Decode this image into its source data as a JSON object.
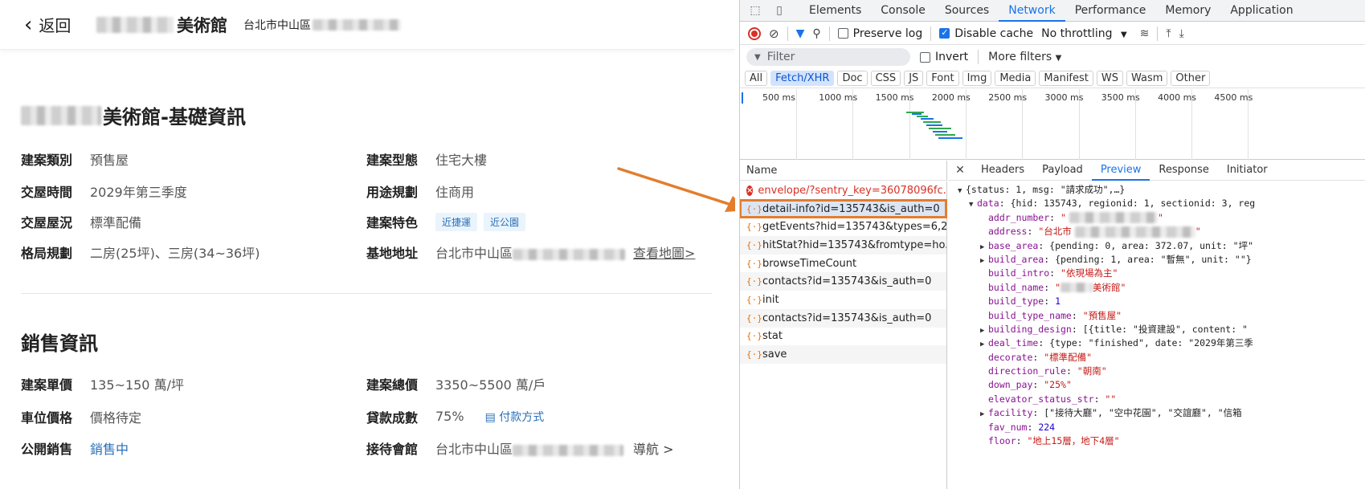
{
  "site": {
    "back_label": "返回",
    "title_suffix": "美術館",
    "address_prefix": "台北市中山區",
    "basic_section": {
      "title_suffix": "美術館-基礎資訊",
      "left": [
        {
          "key": "建案類別",
          "value": "預售屋"
        },
        {
          "key": "交屋時間",
          "value": "2029年第三季度"
        },
        {
          "key": "交屋屋況",
          "value": "標準配備"
        },
        {
          "key": "格局規劃",
          "value": "二房(25坪)、三房(34~36坪)"
        }
      ],
      "right": [
        {
          "key": "建案型態",
          "value": "住宅大樓"
        },
        {
          "key": "用途規劃",
          "value": "住商用"
        },
        {
          "key": "建案特色",
          "tags": [
            "近捷運",
            "近公園"
          ]
        },
        {
          "key": "基地地址",
          "value": "台北市中山區",
          "link": "查看地圖>"
        }
      ]
    },
    "sales_section": {
      "title": "銷售資訊",
      "left": [
        {
          "key": "建案單價",
          "value": "135~150 萬/坪"
        },
        {
          "key": "車位價格",
          "value": "價格待定"
        },
        {
          "key": "公開銷售",
          "value": "銷售中"
        }
      ],
      "right": [
        {
          "key": "建案總價",
          "value": "3350~5500 萬/戶"
        },
        {
          "key": "貸款成數",
          "value": "75%",
          "link": "付款方式"
        },
        {
          "key": "接待會館",
          "value": "台北市中山區",
          "link": "導航 >"
        }
      ]
    }
  },
  "devtools": {
    "tabs": [
      "Elements",
      "Console",
      "Sources",
      "Network",
      "Performance",
      "Memory",
      "Application"
    ],
    "active_tab": "Network",
    "toolbar": {
      "preserve_log": "Preserve log",
      "disable_cache": "Disable cache",
      "throttling": "No throttling"
    },
    "filter": {
      "placeholder": "Filter",
      "invert": "Invert",
      "more_filters": "More filters"
    },
    "types": [
      "All",
      "Fetch/XHR",
      "Doc",
      "CSS",
      "JS",
      "Font",
      "Img",
      "Media",
      "Manifest",
      "WS",
      "Wasm",
      "Other"
    ],
    "active_type": "Fetch/XHR",
    "timeline_labels": [
      "500 ms",
      "1000 ms",
      "1500 ms",
      "2000 ms",
      "2500 ms",
      "3000 ms",
      "3500 ms",
      "4000 ms",
      "4500 ms"
    ],
    "name_header": "Name",
    "requests": [
      {
        "name": "envelope/?sentry_key=36078096fc...",
        "status": "error"
      },
      {
        "name": "detail-info?id=135743&is_auth=0",
        "status": "selected"
      },
      {
        "name": "getEvents?hid=135743&types=6,2...",
        "status": "ok"
      },
      {
        "name": "hitStat?hid=135743&fromtype=ho...",
        "status": "ok"
      },
      {
        "name": "browseTimeCount",
        "status": "ok"
      },
      {
        "name": "contacts?id=135743&is_auth=0",
        "status": "ok"
      },
      {
        "name": "init",
        "status": "ok"
      },
      {
        "name": "contacts?id=135743&is_auth=0",
        "status": "ok"
      },
      {
        "name": "stat",
        "status": "ok"
      },
      {
        "name": "save",
        "status": "ok"
      }
    ],
    "detail_tabs": [
      "Headers",
      "Payload",
      "Preview",
      "Response",
      "Initiator"
    ],
    "active_detail_tab": "Preview",
    "preview_lines": [
      {
        "indent": 0,
        "tri": "▼",
        "text": "{status: 1, msg: \"請求成功\",…}"
      },
      {
        "indent": 1,
        "tri": "▼",
        "key": "data",
        "text": "{hid: 135743, regionid: 1, sectionid: 3, reg"
      },
      {
        "indent": 2,
        "tri": "",
        "key": "addr_number",
        "str": "\""
      },
      {
        "indent": 2,
        "tri": "",
        "key": "address",
        "str": "\"台北市"
      },
      {
        "indent": 2,
        "tri": "▶",
        "key": "base_area",
        "text": "{pending: 0, area: 372.07, unit: \"坪\""
      },
      {
        "indent": 2,
        "tri": "▶",
        "key": "build_area",
        "text": "{pending: 1, area: \"暫無\", unit: \"\"}"
      },
      {
        "indent": 2,
        "tri": "",
        "key": "build_intro",
        "str": "\"依現場為主\""
      },
      {
        "indent": 2,
        "tri": "",
        "key": "build_name",
        "str": "\"美術館\""
      },
      {
        "indent": 2,
        "tri": "",
        "key": "build_type",
        "num": "1"
      },
      {
        "indent": 2,
        "tri": "",
        "key": "build_type_name",
        "str": "\"預售屋\""
      },
      {
        "indent": 2,
        "tri": "▶",
        "key": "building_design",
        "text": "[{title: \"投資建設\", content: \""
      },
      {
        "indent": 2,
        "tri": "▶",
        "key": "deal_time",
        "text": "{type: \"finished\", date: \"2029年第三季"
      },
      {
        "indent": 2,
        "tri": "",
        "key": "decorate",
        "str": "\"標準配備\""
      },
      {
        "indent": 2,
        "tri": "",
        "key": "direction_rule",
        "str": "\"朝南\""
      },
      {
        "indent": 2,
        "tri": "",
        "key": "down_pay",
        "str": "\"25%\""
      },
      {
        "indent": 2,
        "tri": "",
        "key": "elevator_status_str",
        "str": "\"\""
      },
      {
        "indent": 2,
        "tri": "▶",
        "key": "facility",
        "text": "[\"接待大廳\", \"空中花園\", \"交誼廳\", \"信箱"
      },
      {
        "indent": 2,
        "tri": "",
        "key": "fav_num",
        "num": "224"
      },
      {
        "indent": 2,
        "tri": "",
        "key": "floor",
        "str": "\"地上15層，地下4層\""
      }
    ]
  }
}
